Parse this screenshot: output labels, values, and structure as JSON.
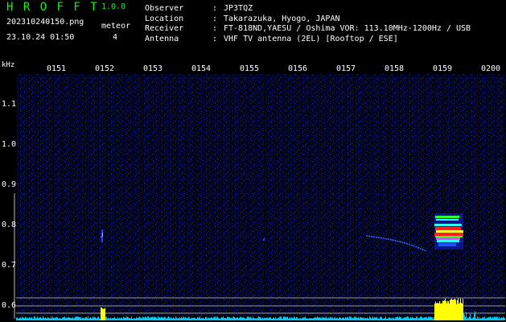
{
  "header": {
    "app_title": "H R O F F T",
    "version": "1.0.0",
    "filename": "202310240150.png",
    "datetime": "23.10.24 01:50",
    "meteor_label": "meteor",
    "meteor_count": "4"
  },
  "station": [
    {
      "key": "Observer",
      "value": "JP3TQZ"
    },
    {
      "key": "Location",
      "value": "Takarazuka, Hyogo, JAPAN"
    },
    {
      "key": "Receiver",
      "value": "FT-818ND,YAESU / Oshima VOR: 113.10MHz-1200Hz / USB"
    },
    {
      "key": "Antenna",
      "value": "VHF TV antenna (2EL) [Rooftop / ESE]"
    }
  ],
  "axis": {
    "unit": "kHz",
    "time_ticks": [
      "0151",
      "0152",
      "0153",
      "0154",
      "0155",
      "0156",
      "0157",
      "0158",
      "0159",
      "0200"
    ],
    "freq_ticks": [
      "1.1",
      "1.0",
      "0.9",
      "0.8",
      "0.7",
      "0.6"
    ]
  },
  "colors": {
    "title": "#00ff00",
    "background": "#000000",
    "noise": "#0a1a8c",
    "baseline": "#00c8ff",
    "baseline_hot": "#ffff00",
    "echo_red": "#ff2020",
    "echo_green": "#30ff30",
    "echo_cyan": "#30ffff",
    "echo_yellow": "#ffff40"
  },
  "echoes": [
    {
      "time": "0152",
      "freq_khz": [
        0.77,
        0.79
      ],
      "intensity": "weak"
    },
    {
      "time": "0155",
      "freq_khz": [
        0.78,
        0.78
      ],
      "intensity": "weak"
    },
    {
      "time": "0158",
      "freq_khz": [
        0.75,
        0.79
      ],
      "intensity": "weak-doppler"
    },
    {
      "time": "0159",
      "freq_khz": [
        0.77,
        0.82
      ],
      "intensity": "strong"
    }
  ]
}
